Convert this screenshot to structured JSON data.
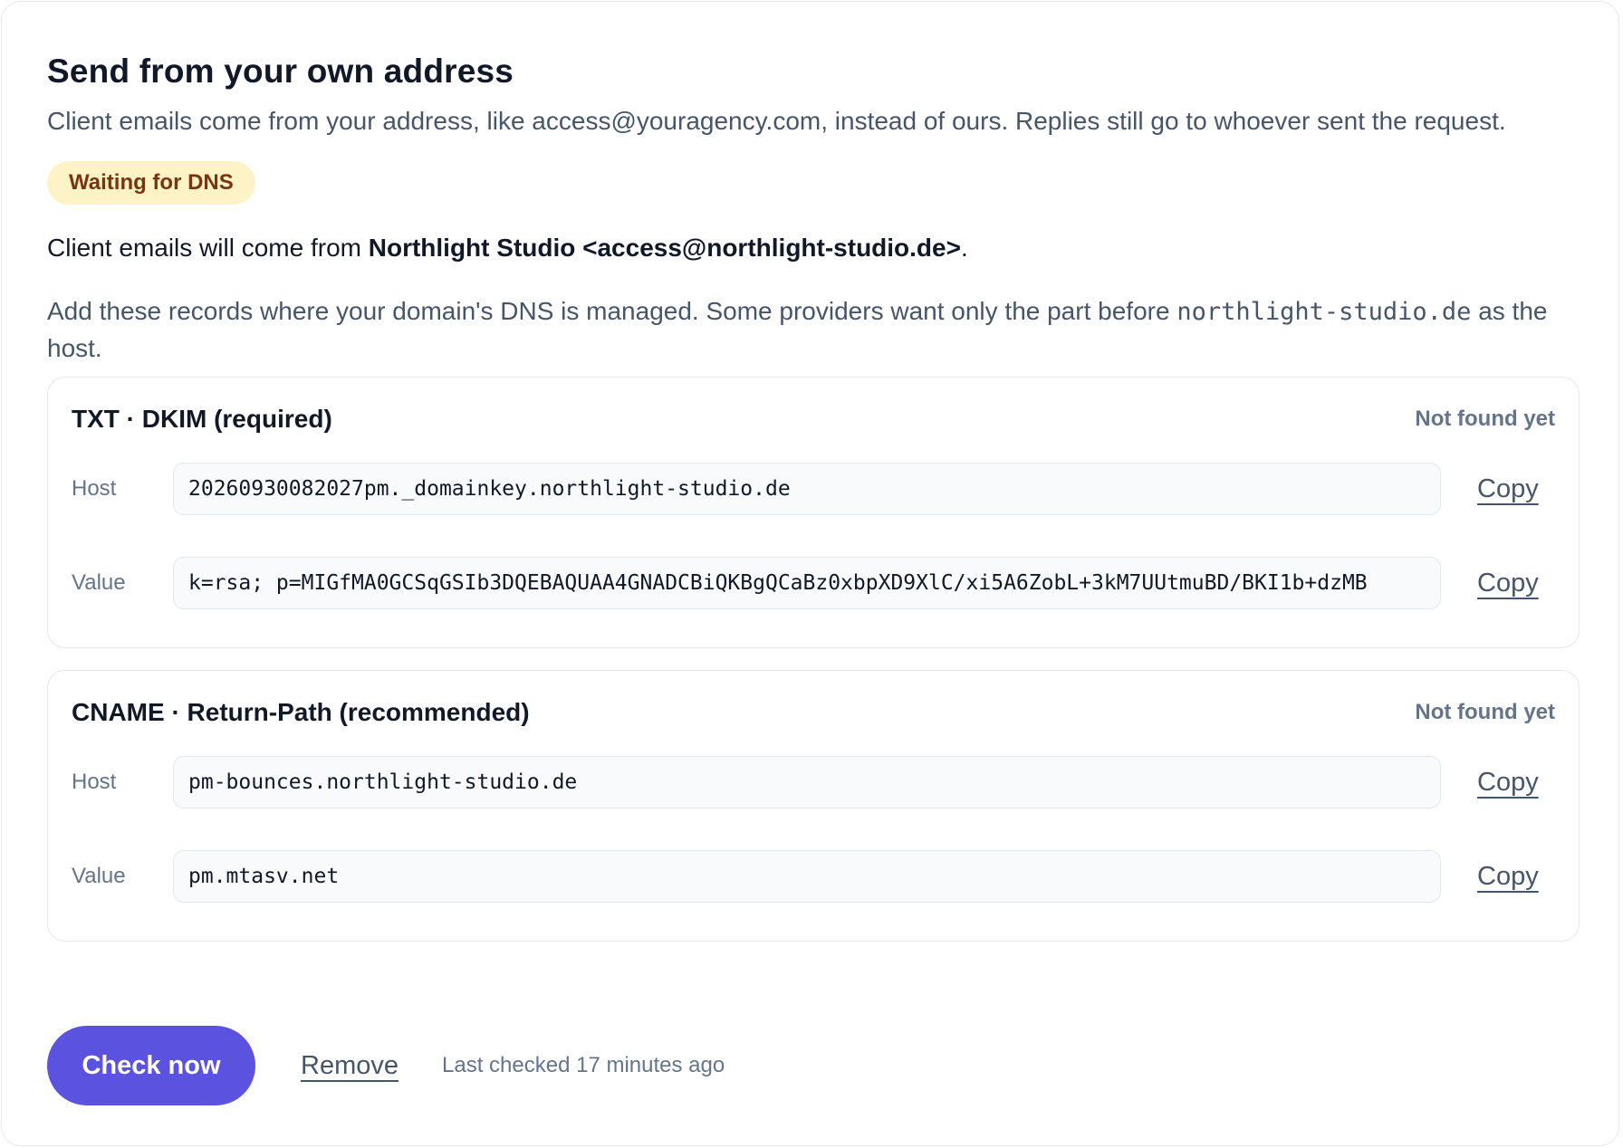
{
  "section": {
    "title": "Send from your own address",
    "description": "Client emails come from your address, like access@youragency.com, instead of ours. Replies still go to whoever sent the request.",
    "status_badge": "Waiting for DNS",
    "from_prefix": "Client emails will come from ",
    "from_address": "Northlight Studio <access@northlight-studio.de>",
    "from_suffix": ".",
    "instructions_prefix": "Add these records where your domain's DNS is managed. Some providers want only the part before ",
    "instructions_domain": "northlight-studio.de",
    "instructions_suffix": " as the host."
  },
  "records": [
    {
      "title": "TXT · DKIM (required)",
      "status": "Not found yet",
      "host_label": "Host",
      "host_value": "20260930082027pm._domainkey.northlight-studio.de",
      "value_label": "Value",
      "value_value": "k=rsa; p=MIGfMA0GCSqGSIb3DQEBAQUAA4GNADCBiQKBgQCaBz0xbpXD9XlC/xi5A6ZobL+3kM7UUtmuBD/BKI1b+dzMB",
      "copy_label": "Copy"
    },
    {
      "title": "CNAME · Return-Path (recommended)",
      "status": "Not found yet",
      "host_label": "Host",
      "host_value": "pm-bounces.northlight-studio.de",
      "value_label": "Value",
      "value_value": "pm.mtasv.net",
      "copy_label": "Copy"
    }
  ],
  "actions": {
    "check_now_label": "Check now",
    "remove_label": "Remove",
    "last_checked": "Last checked 17 minutes ago"
  },
  "colors": {
    "primary": "#5b53e0",
    "badge_bg": "#fef3c7",
    "badge_text": "#78350f",
    "muted_text": "#64748b"
  }
}
